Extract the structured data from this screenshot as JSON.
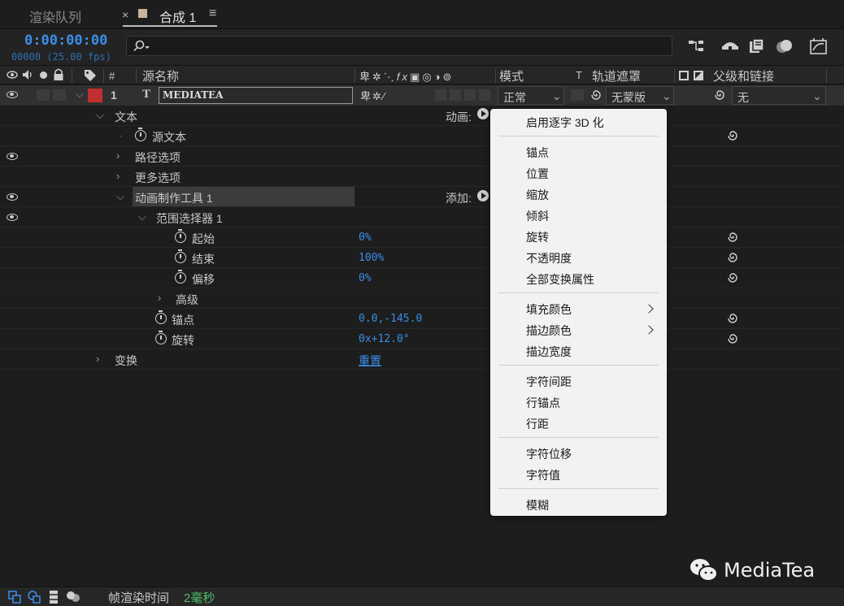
{
  "tabs": [
    {
      "label": "渲染队列",
      "active": false
    },
    {
      "label": "合成 1",
      "active": true
    }
  ],
  "timecode": "0:00:00:00",
  "frame_info": "00000 (25.00 fps)",
  "search": {
    "placeholder": ""
  },
  "columns": {
    "source_name": "源名称",
    "mode": "模式",
    "t": "T",
    "track_matte": "轨道遮罩",
    "parent": "父级和链接",
    "number": "#"
  },
  "layer": {
    "index": "1",
    "type_glyph": "T",
    "name": "MEDIATEA",
    "mode": "正常",
    "matte": "无蒙版",
    "parent": "无",
    "label_color": "#c13030"
  },
  "properties": {
    "text": "文本",
    "animate_label": "动画:",
    "source_text": "源文本",
    "path_options": "路径选项",
    "more_options": "更多选项",
    "animator": "动画制作工具 1",
    "add_label": "添加:",
    "range_selector": "范围选择器 1",
    "start": {
      "label": "起始",
      "value": "0%"
    },
    "end": {
      "label": "结束",
      "value": "100%"
    },
    "offset": {
      "label": "偏移",
      "value": "0%"
    },
    "advanced": "高级",
    "anchor": {
      "label": "锚点",
      "value": "0.0,-145.0"
    },
    "rotation": {
      "label": "旋转",
      "value": "0x+12.0°"
    },
    "transform": "变换",
    "reset": "重置"
  },
  "menu": {
    "groups": [
      [
        "启用逐字 3D 化"
      ],
      [
        "锚点",
        "位置",
        "缩放",
        "倾斜",
        "旋转",
        "不透明度",
        "全部变换属性"
      ],
      [
        "填充颜色",
        "描边颜色",
        "描边宽度"
      ],
      [
        "字符间距",
        "行锚点",
        "行距"
      ],
      [
        "字符位移",
        "字符值"
      ],
      [
        "模糊"
      ]
    ],
    "submenu_items": [
      "填充颜色",
      "描边颜色"
    ]
  },
  "footer": {
    "render_label": "帧渲染时间",
    "render_value": "2毫秒"
  },
  "watermark": "MediaTea",
  "colors": {
    "accent_blue": "#3b8de8",
    "green": "#4fc26b",
    "menu_bg": "#f2f2f2",
    "panel_bg": "#1d1d1d"
  }
}
